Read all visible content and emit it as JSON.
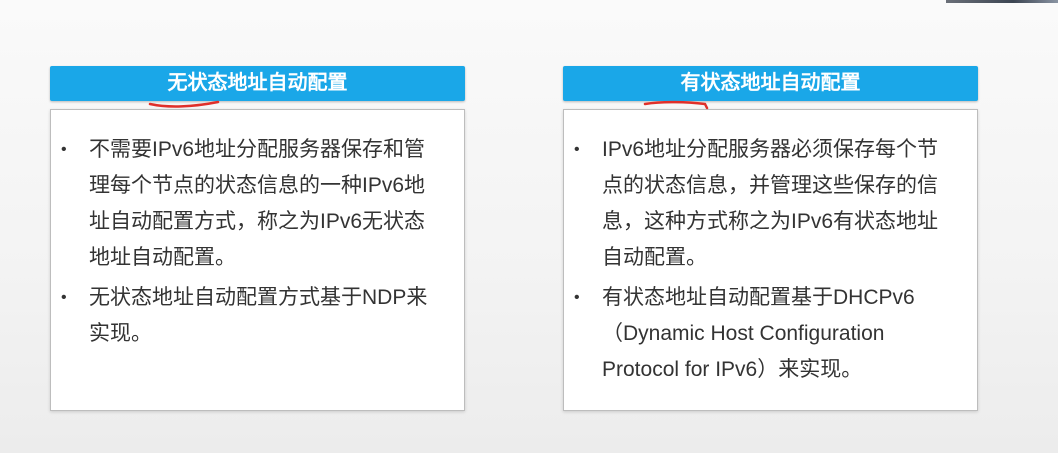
{
  "left_panel": {
    "title": "无状态地址自动配置",
    "bullets": [
      "不需要IPv6地址分配服务器保存和管理每个节点的状态信息的一种IPv6地址自动配置方式，称之为IPv6无状态地址自动配置。",
      "无状态地址自动配置方式基于NDP来实现。"
    ]
  },
  "right_panel": {
    "title": "有状态地址自动配置",
    "bullets": [
      "IPv6地址分配服务器必须保存每个节点的状态信息，并管理这些保存的信息，这种方式称之为IPv6有状态地址自动配置。",
      "有状态地址自动配置基于DHCPv6（Dynamic Host Configuration Protocol for IPv6）来实现。"
    ]
  },
  "bullet_glyph": "•",
  "colors": {
    "header_blue": "#1aa7e8",
    "annotation_red": "#e0302a"
  }
}
